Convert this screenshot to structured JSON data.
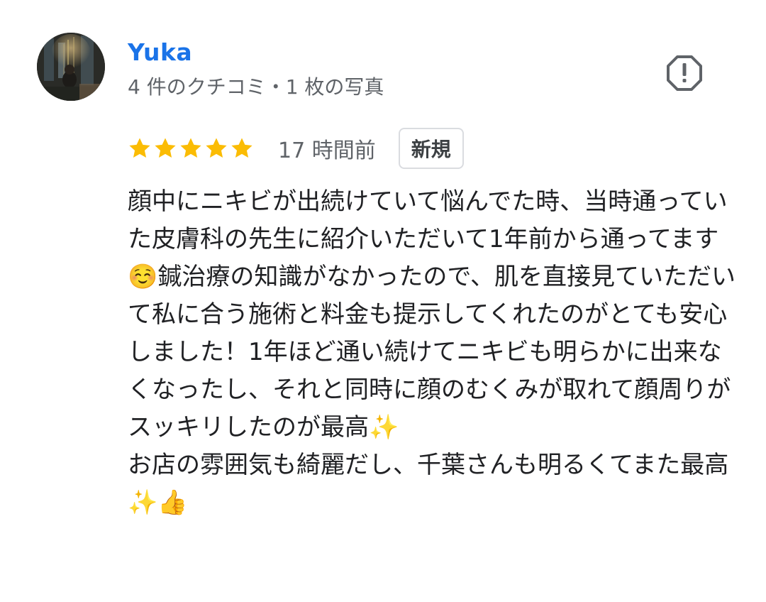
{
  "review": {
    "author": {
      "name": "Yuka",
      "meta": "4 件のクチコミ・1 枚の写真",
      "avatar_icon": "profile-photo-night-city"
    },
    "report_icon": "report-flag-icon",
    "rating": {
      "value": 5,
      "max": 5,
      "star_color": "#fbbc04"
    },
    "time": "17 時間前",
    "badge": "新規",
    "text": "顔中にニキビが出続けていて悩んでた時、当時通っていた皮膚科の先生に紹介いただいて1年前から通ってます☺️鍼治療の知識がなかったので、肌を直接見ていただいて私に合う施術と料金も提示してくれたのがとても安心しました！1年ほど通い続けてニキビも明らかに出来なくなったし、それと同時に顔のむくみが取れて顔周りがスッキリしたのが最高✨\nお店の雰囲気も綺麗だし、千葉さんも明るくてまた最高✨👍"
  },
  "colors": {
    "author_name": "#1a73e8",
    "meta_text": "#5f6368",
    "body_text": "#202124",
    "badge_border": "#dadce0"
  }
}
